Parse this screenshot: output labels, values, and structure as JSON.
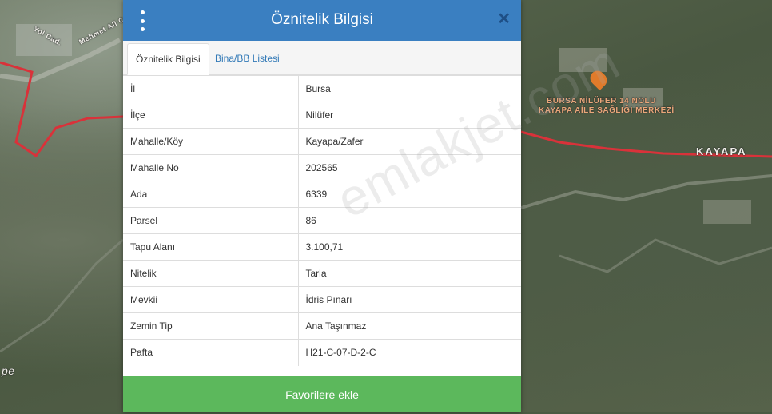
{
  "map": {
    "labels": {
      "street": "Mehmet Ali Cad.",
      "street2": "Yol Cad.",
      "poi": "BURSA NİLÜFER 14 NOLU\nKAYAPA AİLE SAĞLIĞI MERKEZİ",
      "poi_line1": "BURSA NİLÜFER 14 NOLU",
      "poi_line2": "KAYAPA AİLE SAĞLIĞI MERKEZİ",
      "neighborhood": "KAYAPA",
      "edge": "pe"
    },
    "colors": {
      "boundary": "#d9323a",
      "poi_marker": "#e07b2b"
    }
  },
  "panel": {
    "title": "Öznitelik Bilgisi",
    "menu_icon": "vertical-dots-icon",
    "close_icon": "close-icon",
    "tabs": [
      {
        "label": "Öznitelik Bilgisi",
        "active": true
      },
      {
        "label": "Bina/BB Listesi",
        "active": false
      }
    ],
    "rows": [
      {
        "key": "İl",
        "value": "Bursa"
      },
      {
        "key": "İlçe",
        "value": "Nilüfer"
      },
      {
        "key": "Mahalle/Köy",
        "value": "Kayapa/Zafer"
      },
      {
        "key": "Mahalle No",
        "value": "202565"
      },
      {
        "key": "Ada",
        "value": "6339"
      },
      {
        "key": "Parsel",
        "value": "86"
      },
      {
        "key": "Tapu Alanı",
        "value": "3.100,71"
      },
      {
        "key": "Nitelik",
        "value": "Tarla"
      },
      {
        "key": "Mevkii",
        "value": "İdris Pınarı"
      },
      {
        "key": "Zemin Tip",
        "value": "Ana Taşınmaz"
      },
      {
        "key": "Pafta",
        "value": "H21-C-07-D-2-C"
      }
    ],
    "favorite_button": "Favorilere ekle",
    "watermark": "emlakjet.com",
    "colors": {
      "header": "#3a7fc1",
      "button": "#5cb85c",
      "tab_link": "#337ab7"
    }
  }
}
